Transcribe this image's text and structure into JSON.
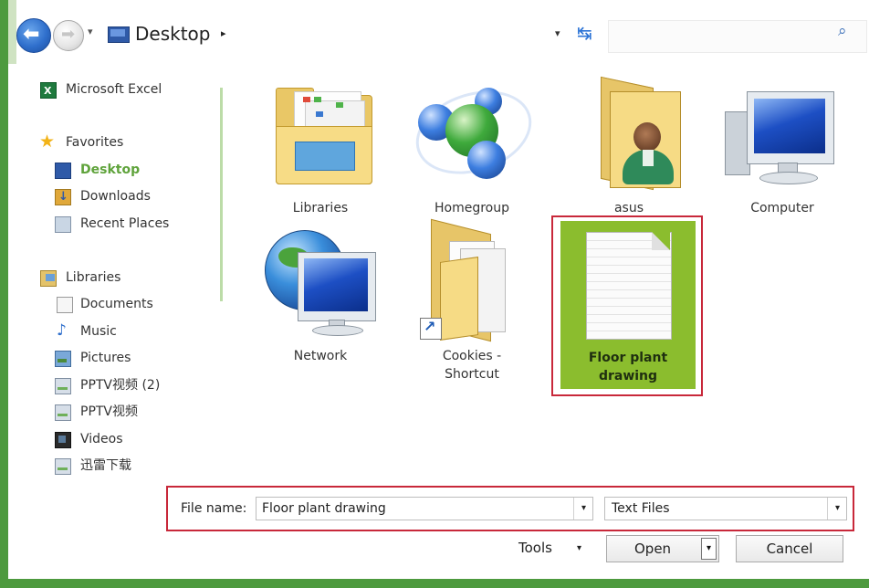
{
  "address": {
    "location": "Desktop",
    "separator_glyph": "▸",
    "dropdown_glyph": "▾",
    "refresh_glyph": "↹",
    "search_placeholder": "",
    "icons": [
      "back-arrow-icon",
      "forward-arrow-icon",
      "desktop-icon",
      "refresh-icon",
      "search-icon"
    ]
  },
  "navigation": {
    "items": [
      {
        "label": "Microsoft Excel",
        "icon": "excel-icon"
      },
      {
        "label": "Favorites",
        "icon": "star-icon"
      },
      {
        "label": "Desktop",
        "icon": "desktop-icon",
        "selected": true
      },
      {
        "label": "Downloads",
        "icon": "downloads-icon"
      },
      {
        "label": "Recent Places",
        "icon": "recent-places-icon"
      },
      {
        "label": "Libraries",
        "icon": "libraries-icon"
      },
      {
        "label": "Documents",
        "icon": "document-icon"
      },
      {
        "label": "Music",
        "icon": "music-icon"
      },
      {
        "label": "Pictures",
        "icon": "pictures-icon"
      },
      {
        "label": "PPTV视频 (2)",
        "icon": "drive-icon"
      },
      {
        "label": "PPTV视频",
        "icon": "drive-icon"
      },
      {
        "label": "Videos",
        "icon": "videos-icon"
      },
      {
        "label": "迅雷下载",
        "icon": "drive-icon"
      }
    ]
  },
  "content": {
    "items": [
      {
        "label": "Libraries",
        "icon": "libraries-folder-icon"
      },
      {
        "label": "Homegroup",
        "icon": "homegroup-icon"
      },
      {
        "label": "asus",
        "icon": "user-folder-icon"
      },
      {
        "label": "Computer",
        "icon": "computer-icon"
      },
      {
        "label": "Network",
        "icon": "network-icon"
      },
      {
        "label_line1": "Cookies -",
        "label_line2": "Shortcut",
        "icon": "shortcut-folder-icon"
      },
      {
        "label_line1": "Floor plant",
        "label_line2": "drawing",
        "icon": "text-file-icon",
        "selected": true
      }
    ]
  },
  "bottom": {
    "filename_label": "File name:",
    "filename_value": "Floor plant drawing",
    "filetype_value": "Text Files",
    "dropdown_glyph": "▾",
    "tools_label": "Tools",
    "open_label": "Open",
    "cancel_label": "Cancel"
  },
  "colors": {
    "accent_green": "#4d9a3e",
    "selection_green": "#8bbd2e",
    "highlight_red": "#c8283a"
  }
}
